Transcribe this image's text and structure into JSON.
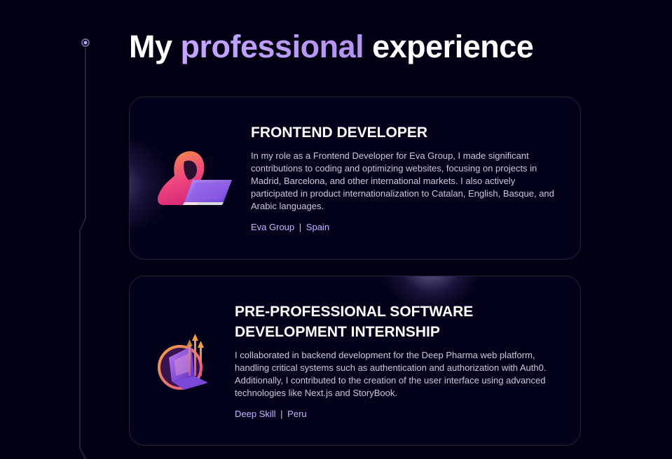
{
  "section": {
    "title_prefix": "My",
    "title_accent": "professional",
    "title_suffix": "experience"
  },
  "experiences": [
    {
      "role": "FRONTEND DEVELOPER",
      "description": "In my role as a Frontend Developer for Eva Group, I made significant contributions to coding and optimizing websites, focusing on projects in Madrid, Barcelona, and other international markets. I also actively participated in product internationalization to Catalan, English, Basque, and Arabic languages.",
      "company": "Eva Group",
      "separator": "|",
      "location": "Spain",
      "icon": "hooded-developer-laptop-icon"
    },
    {
      "role": "PRE-PROFESSIONAL SOFTWARE DEVELOPMENT INTERNSHIP",
      "description": "I collaborated in backend development for the Deep Pharma web platform, handling critical systems such as authentication and authorization with Auth0. Additionally, I contributed to the creation of the user interface using advanced technologies like Next.js and StoryBook.",
      "company": "Deep Skill",
      "separator": "|",
      "location": "Peru",
      "icon": "laptop-growth-arrows-icon"
    }
  ],
  "colors": {
    "background": "#030014",
    "accent": "#c4a6ff",
    "card_border": "#24233a",
    "text_muted": "#c9c7d8"
  }
}
